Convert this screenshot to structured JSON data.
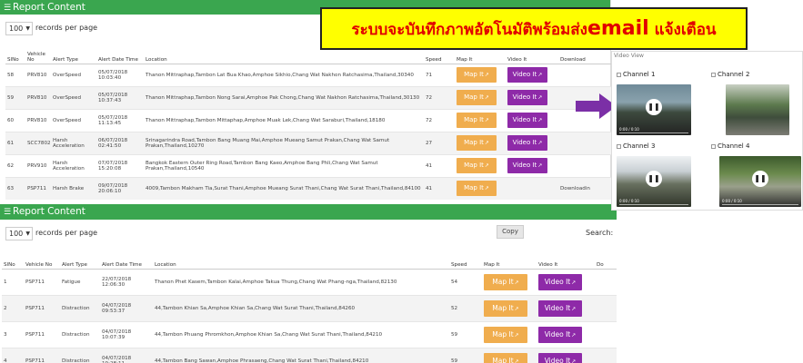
{
  "banner": {
    "text_before": "ระบบจะบันทึกภาพอัตโนมัติพร้อมส่ง",
    "text_email": "email",
    "text_after": " แจ้งเตือน"
  },
  "top_panel": {
    "title": "Report Content",
    "page_length": "100",
    "records_label": "records per page",
    "columns": [
      "SlNo",
      "Vehicle No",
      "Alert Type",
      "Alert Date Time",
      "Location",
      "Speed",
      "Map It",
      "Video It",
      "Download"
    ],
    "rows": [
      {
        "no": "58",
        "vehicle": "PRV810",
        "alert": "OverSpeed",
        "datetime": "05/07/2018 10:03:40",
        "location": "Thanon Mittraphap,Tambon Lat Bua Khao,Amphoe Sikhio,Chang Wat Nakhon Ratchasima,Thailand,30340",
        "speed": "71",
        "map": "Map It",
        "video": "Video It",
        "download": ""
      },
      {
        "no": "59",
        "vehicle": "PRV810",
        "alert": "OverSpeed",
        "datetime": "05/07/2018 10:37:43",
        "location": "Thanon Mittraphap,Tambon Nong Sarai,Amphoe Pak Chong,Chang Wat Nakhon Ratchasima,Thailand,30130",
        "speed": "72",
        "map": "Map It",
        "video": "Video It",
        "download": ""
      },
      {
        "no": "60",
        "vehicle": "PRV810",
        "alert": "OverSpeed",
        "datetime": "05/07/2018 11:13:45",
        "location": "Thanon Mittraphap,Tambon Mittaphap,Amphoe Muak Lek,Chang Wat Saraburi,Thailand,18180",
        "speed": "72",
        "map": "Map It",
        "video": "Video It",
        "download": ""
      },
      {
        "no": "61",
        "vehicle": "SCC7802",
        "alert": "Harsh Acceleration",
        "datetime": "06/07/2018 02:41:50",
        "location": "Srinagarindra Road,Tambon Bang Muang Mai,Amphoe Mueang Samut Prakan,Chang Wat Samut Prakan,Thailand,10270",
        "speed": "27",
        "map": "Map It",
        "video": "Video It",
        "download": ""
      },
      {
        "no": "62",
        "vehicle": "PRV910",
        "alert": "Harsh Acceleration",
        "datetime": "07/07/2018 15:20:08",
        "location": "Bangkok Eastern Outer Ring Road,Tambon Bang Kaeo,Amphoe Bang Phli,Chang Wat Samut Prakan,Thailand,10540",
        "speed": "41",
        "map": "Map It",
        "video": "Video It",
        "download": ""
      },
      {
        "no": "63",
        "vehicle": "PSP711",
        "alert": "Harsh Brake",
        "datetime": "09/07/2018 20:06:10",
        "location": "4009,Tambon Makham Tia,Surat Thani,Amphoe Mueang Surat Thani,Chang Wat Surat Thani,Thailand,84100",
        "speed": "41",
        "map": "Map It",
        "video": "",
        "download": "Downloadin"
      }
    ]
  },
  "video_view": {
    "title": "Video View",
    "channels": [
      {
        "label": "Channel 1",
        "time": "0:00 / 0:10"
      },
      {
        "label": "Channel 2",
        "time": ""
      },
      {
        "label": "Channel 3",
        "time": "0:00 / 0:10"
      },
      {
        "label": "Channel 4",
        "time": "0:00 / 0:10"
      }
    ],
    "pause_glyph": "❚❚"
  },
  "bottom_panel": {
    "title": "Report Content",
    "page_length": "100",
    "records_label": "records per page",
    "copy_label": "Copy",
    "search_label": "Search:",
    "columns": [
      "SlNo",
      "Vehicle No",
      "Alert Type",
      "Alert Date Time",
      "Location",
      "Speed",
      "Map It",
      "Video It",
      "Do"
    ],
    "rows": [
      {
        "no": "1",
        "vehicle": "PSP711",
        "alert": "Fatigue",
        "datetime": "22/07/2018 12:06:30",
        "location": "Thanon Phet Kasem,Tambon Kalai,Amphoe Takua Thung,Chang Wat Phang-nga,Thailand,82130",
        "speed": "54",
        "map": "Map It",
        "video": "Video It"
      },
      {
        "no": "2",
        "vehicle": "PSP711",
        "alert": "Distraction",
        "datetime": "04/07/2018 09:53:37",
        "location": "44,Tambon Khian Sa,Amphoe Khian Sa,Chang Wat Surat Thani,Thailand,84260",
        "speed": "52",
        "map": "Map It",
        "video": "Video It"
      },
      {
        "no": "3",
        "vehicle": "PSP711",
        "alert": "Distraction",
        "datetime": "04/07/2018 10:07:39",
        "location": "44,Tambon Phuang Phromkhon,Amphoe Khian Sa,Chang Wat Surat Thani,Thailand,84210",
        "speed": "59",
        "map": "Map It",
        "video": "Video It"
      },
      {
        "no": "4",
        "vehicle": "PSP711",
        "alert": "Distraction",
        "datetime": "04/07/2018 10:28:11",
        "location": "44,Tambon Bang Sawan,Amphoe Phrasaeng,Chang Wat Surat Thani,Thailand,84210",
        "speed": "59",
        "map": "Map It",
        "video": "Video It"
      }
    ]
  },
  "colors": {
    "header_green": "#3aa64f",
    "map_button": "#f0ad4e",
    "video_button": "#8e2aa8",
    "banner_bg": "#ffff00",
    "banner_text": "#e10000",
    "arrow": "#7b2fa6"
  },
  "icons": {
    "menu": "hamburger-icon",
    "external": "external-link-icon",
    "pause": "pause-icon",
    "arrow": "arrow-right-icon"
  }
}
